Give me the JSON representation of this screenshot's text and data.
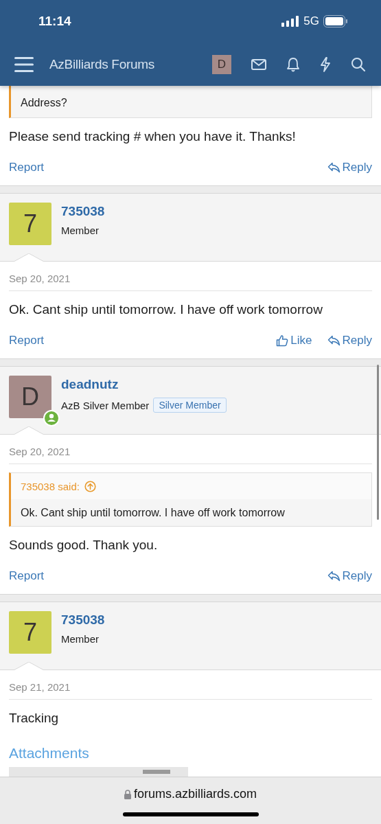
{
  "status_bar": {
    "time": "11:14",
    "network": "5G"
  },
  "header": {
    "title": "AzBilliards Forums",
    "avatar_letter": "D"
  },
  "posts": [
    {
      "quote": {
        "text": "Address?"
      },
      "body": "Please send tracking # when you have it. Thanks!",
      "actions": [
        {
          "kind": "report",
          "label": "Report"
        },
        {
          "kind": "reply",
          "label": "Reply"
        }
      ]
    },
    {
      "user": {
        "avatar": "7",
        "color": "#cdd152",
        "online": false,
        "name": "735038",
        "role": "Member"
      },
      "date": "Sep 20, 2021",
      "body": "Ok. Cant ship until tomorrow. I have off work tomorrow",
      "actions": [
        {
          "kind": "report",
          "label": "Report"
        },
        {
          "kind": "like",
          "label": "Like"
        },
        {
          "kind": "reply",
          "label": "Reply"
        }
      ]
    },
    {
      "user": {
        "avatar": "D",
        "color": "#a68b89",
        "online": true,
        "name": "deadnutz",
        "role": "AzB Silver Member",
        "badge": "Silver Member"
      },
      "date": "Sep 20, 2021",
      "quote": {
        "author": "735038 said:",
        "text": "Ok. Cant ship until tomorrow. I have off work tomorrow"
      },
      "body": "Sounds good. Thank you.",
      "actions": [
        {
          "kind": "report",
          "label": "Report"
        },
        {
          "kind": "reply",
          "label": "Reply"
        }
      ]
    },
    {
      "user": {
        "avatar": "7",
        "color": "#cdd152",
        "online": false,
        "name": "735038",
        "role": "Member"
      },
      "date": "Sep 21, 2021",
      "body": "Tracking",
      "attachments": {
        "heading": "Attachments"
      }
    }
  ],
  "browser": {
    "url": "forums.azbilliards.com"
  }
}
